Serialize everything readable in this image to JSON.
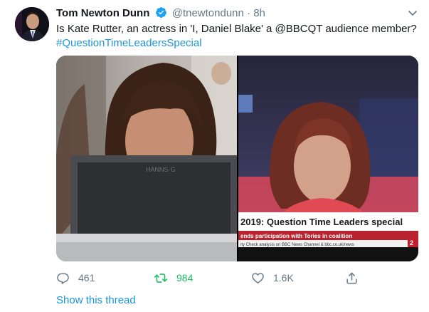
{
  "author": {
    "name": "Tom Newton Dunn",
    "handle": "@tnewtondunn",
    "separator": "·",
    "time": "8h"
  },
  "tweet": {
    "text": "Is Kate Rutter, an actress in 'I, Daniel Blake' a @BBCQT audience member?",
    "hashtag": "#QuestionTimeLeadersSpecial"
  },
  "media": {
    "left_image": {
      "monitor_brand": "HANNS·G"
    },
    "right_image": {
      "banner_title": "2019: Question Time Leaders special",
      "banner_subtitle": "ends participation with Tories in coalition",
      "ticker_text": "ity Check analysis on BBC News Channel & bbc.co.uk/news",
      "channel_badge": "2"
    }
  },
  "actions": {
    "reply": {
      "icon": "reply-icon",
      "count": "461"
    },
    "retweet": {
      "icon": "retweet-icon",
      "count": "984",
      "active_color": "#17bf63"
    },
    "like": {
      "icon": "heart-icon",
      "count": "1.6K"
    },
    "share": {
      "icon": "share-icon"
    }
  },
  "thread_link": "Show this thread",
  "colors": {
    "link": "#1b95e0",
    "secondary_text": "#657786",
    "verified": "#1da1f2"
  }
}
